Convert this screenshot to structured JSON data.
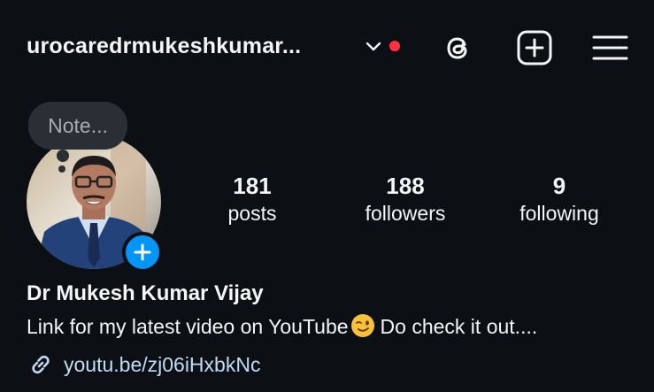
{
  "header": {
    "username": "urocaredrmukeshkumar...",
    "has_notification_dot": true,
    "notification_color": "#ff3040"
  },
  "icons": {
    "threads": "threads-icon",
    "create": "plus-square-icon",
    "menu": "hamburger-menu-icon",
    "chevron": "chevron-down-icon",
    "link": "link-icon"
  },
  "note": {
    "placeholder": "Note..."
  },
  "stats": [
    {
      "value": "181",
      "label": "posts"
    },
    {
      "value": "188",
      "label": "followers"
    },
    {
      "value": "9",
      "label": "following"
    }
  ],
  "profile": {
    "full_name": "Dr Mukesh Kumar Vijay",
    "bio_text": "Link for my latest video on YouTube",
    "bio_suffix": "Do check it out....",
    "link": "youtu.be/zj06iHxbkNc"
  },
  "colors": {
    "background": "#0c1014",
    "accent": "#0095f6",
    "link": "#c0dcf7"
  }
}
